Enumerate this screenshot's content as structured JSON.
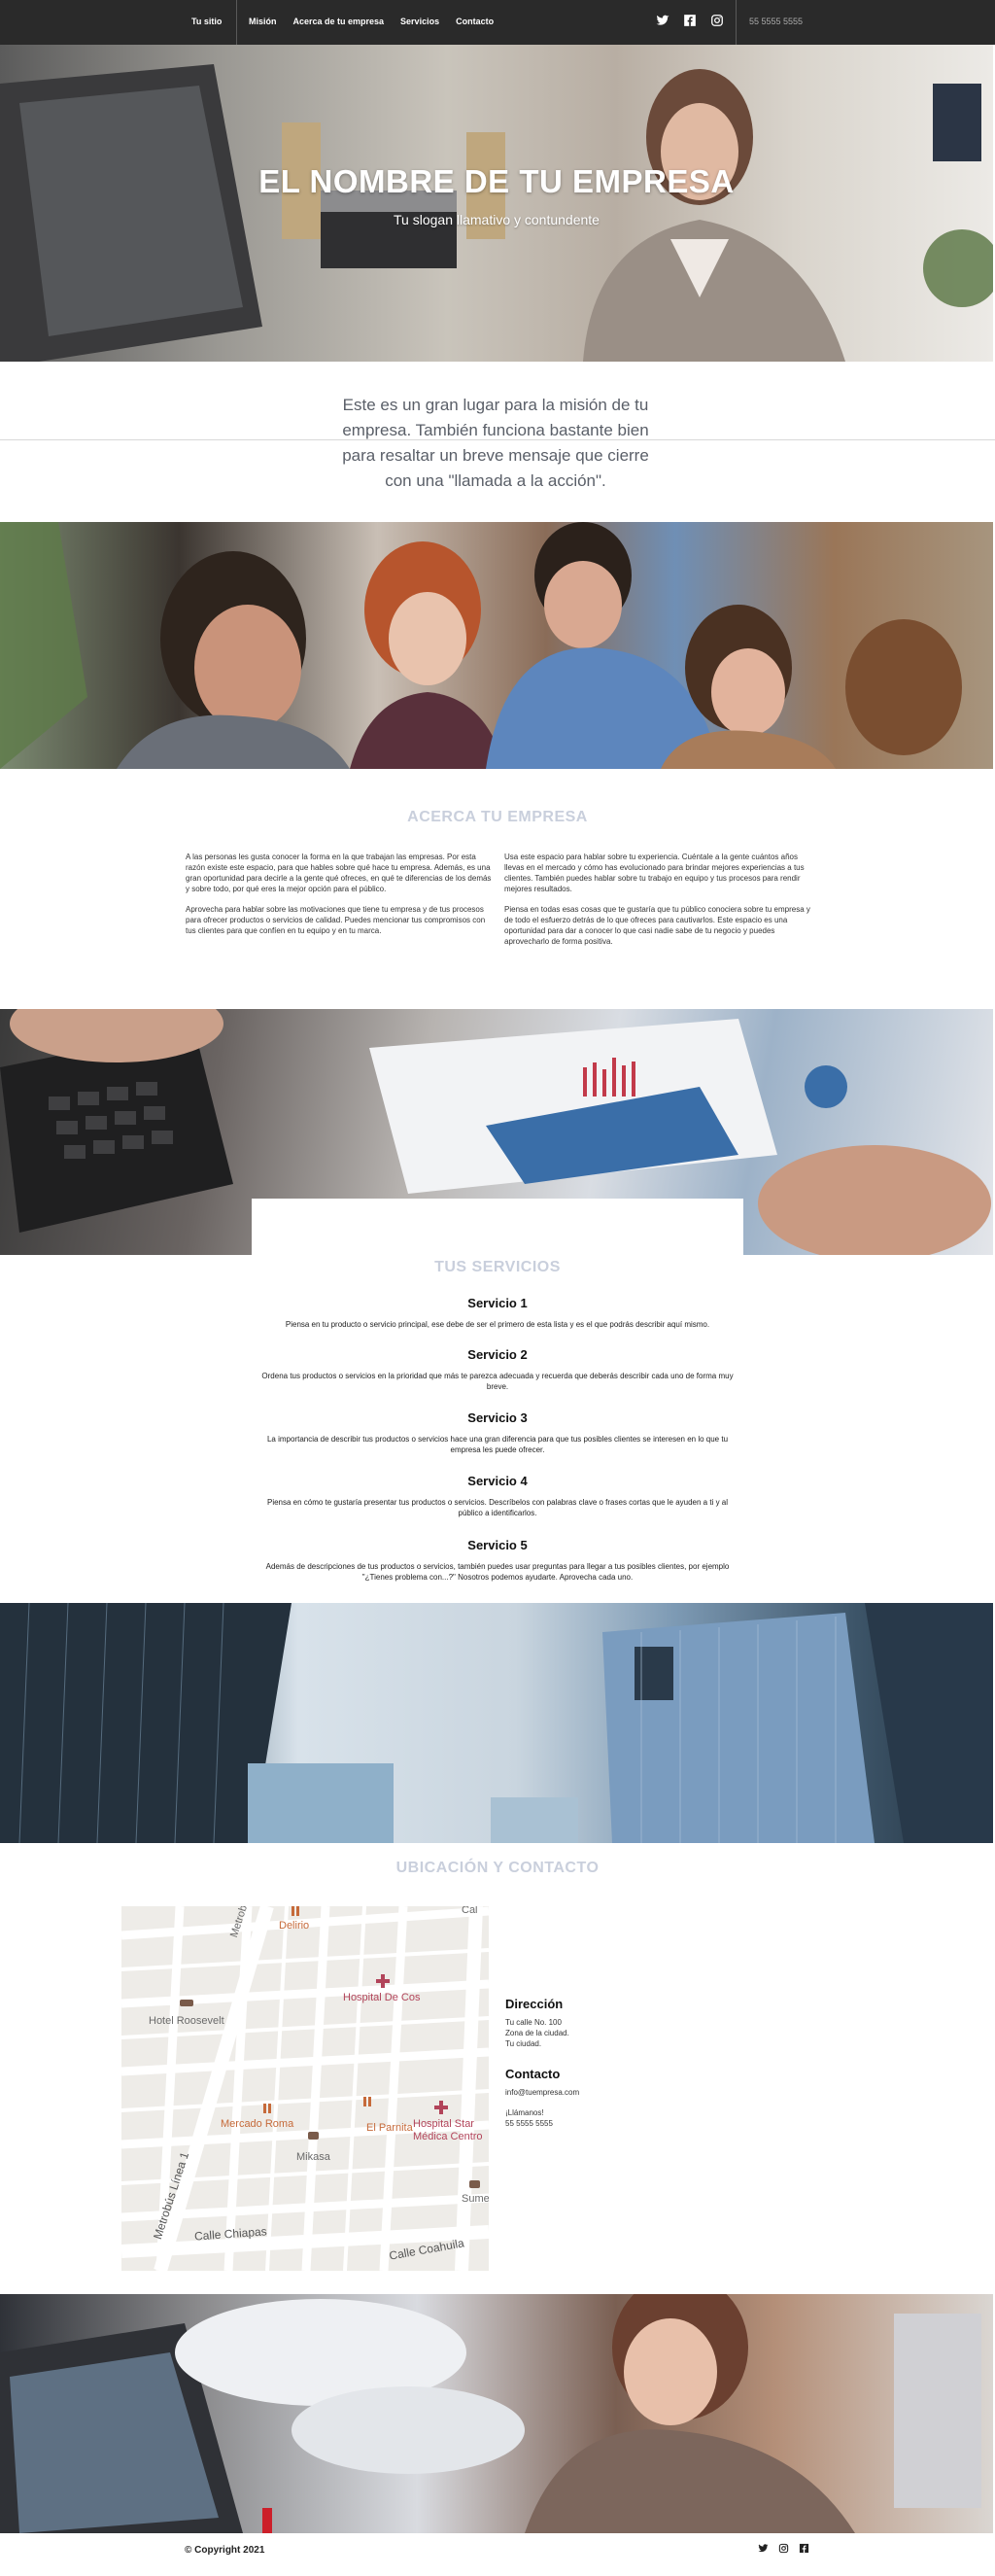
{
  "nav": {
    "site_name": "Tu sitio",
    "menu": [
      "Misión",
      "Acerca de tu empresa",
      "Servicios",
      "Contacto"
    ],
    "social": [
      "twitter-icon",
      "facebook-icon",
      "instagram-icon"
    ],
    "phone": "55 5555 5555"
  },
  "hero": {
    "title": "EL NOMBRE DE TU EMPRESA",
    "slogan": "Tu slogan llamativo y contundente"
  },
  "mission": {
    "text": "Este es un gran lugar para la misión de tu empresa. También funciona bastante bien para resaltar un breve mensaje que cierre con una \"llamada a la acción\"."
  },
  "about": {
    "title": "ACERCA TU EMPRESA",
    "left": [
      "A las personas les gusta conocer la forma en la que trabajan las empresas. Por esta razón existe este espacio, para que hables sobre qué hace tu empresa. Además, es una gran oportunidad para decirle a la gente qué ofreces, en qué te diferencias de los demás y sobre todo, por qué eres la mejor opción para el público.",
      "Aprovecha para hablar sobre las motivaciones que tiene tu empresa y de tus procesos para ofrecer productos o servicios de calidad. Puedes mencionar tus compromisos con tus clientes para que confíen en tu equipo y en tu marca."
    ],
    "right": [
      "Usa este espacio para hablar sobre tu experiencia. Cuéntale a la gente cuántos años llevas en el mercado y cómo has evolucionado para brindar mejores experiencias a tus clientes. También puedes hablar sobre tu trabajo en equipo y tus procesos para rendir mejores resultados.",
      "Piensa en todas esas cosas que te gustaría que tu público conociera sobre tu empresa y de todo el esfuerzo detrás de lo que ofreces para cautivarlos. Este espacio es una oportunidad para dar a conocer lo que casi nadie sabe de tu negocio y puedes aprovecharlo de forma positiva."
    ]
  },
  "services": {
    "title": "TUS SERVICIOS",
    "items": [
      {
        "name": "Servicio 1",
        "desc": "Piensa en tu producto o servicio principal, ese debe de ser el primero de esta lista y es el que podrás describir aquí mismo."
      },
      {
        "name": "Servicio 2",
        "desc": "Ordena tus productos o servicios en la prioridad que más te parezca adecuada y recuerda que deberás describir cada uno de forma muy breve."
      },
      {
        "name": "Servicio 3",
        "desc": "La importancia de describir tus productos o servicios hace una gran diferencia para que tus posibles clientes se interesen en lo que tu empresa les puede ofrecer."
      },
      {
        "name": "Servicio 4",
        "desc": "Piensa en cómo te gustaría presentar tus productos o servicios. Descríbelos con palabras clave o frases cortas que le ayuden a ti y al público a identificarlos."
      },
      {
        "name": "Servicio 5",
        "desc": "Además de descripciones de tus productos o servicios, también puedes usar preguntas para llegar a tus posibles clientes, por ejemplo \"¿Tienes problema con...?\" Nosotros podemos ayudarte. Aprovecha cada uno."
      }
    ]
  },
  "contact": {
    "title": "UBICACIÓN Y CONTACTO",
    "address_heading": "Dirección",
    "address_lines": [
      "Tu calle No. 100",
      "Zona de la ciudad.",
      "Tu ciudad."
    ],
    "contact_heading": "Contacto",
    "email": "info@tuempresa.com",
    "call_label": "¡Llámanos!",
    "phone": "55 5555 5555",
    "map_labels": {
      "delirio": "Delirio",
      "hospital_cos": "Hospital De Cos",
      "hotel": "Hotel Roosevelt",
      "mercado": "Mercado Roma",
      "parnita": "El Parnita",
      "hospital_star": "Hospital Star Médica Centro",
      "mikasa": "Mikasa",
      "sumesa": "Sumes",
      "metrobus_top": "Metrobús",
      "metrobus_linea": "Metrobús Línea 1",
      "calle_chiapas": "Calle Chiapas",
      "calle_coahuila": "Calle Coahuila",
      "cal": "Cal"
    }
  },
  "footer": {
    "copyright": "© Copyright 2021",
    "social": [
      "twitter-icon",
      "instagram-icon",
      "facebook-icon"
    ]
  }
}
